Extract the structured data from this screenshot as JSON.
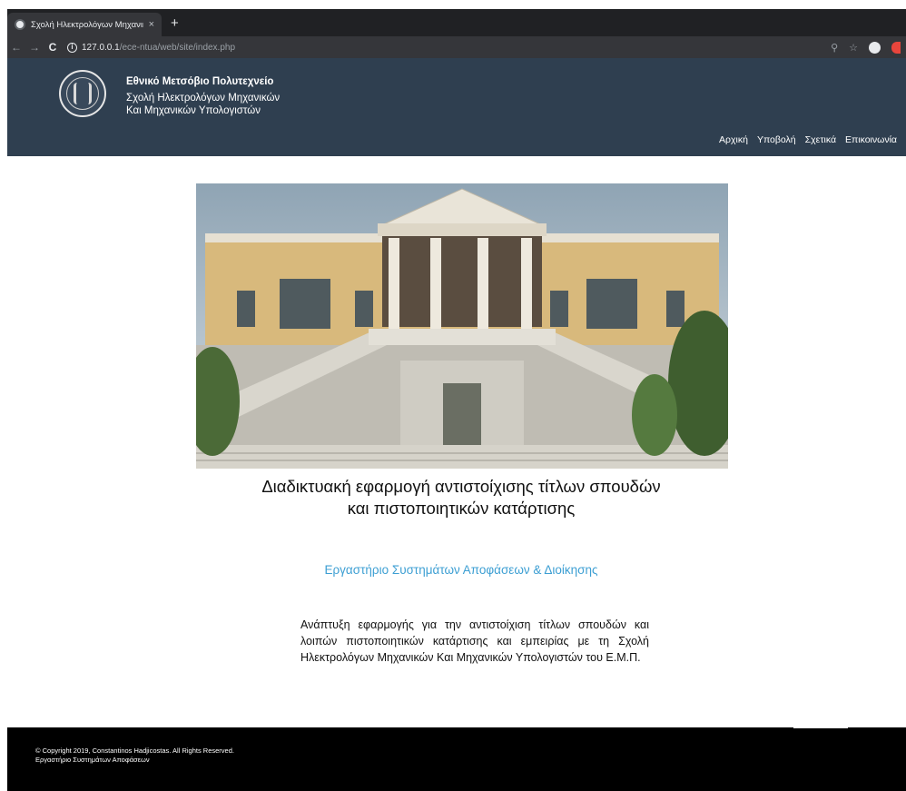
{
  "browser": {
    "tab_title": "Σχολή Ηλεκτρολόγων Μηχανικ",
    "tab_close": "×",
    "new_tab": "+",
    "back": "←",
    "forward": "→",
    "reload": "C",
    "url_host": "127.0.0.1",
    "url_path": "/ece-ntua/web/site/index.php",
    "icons": [
      "tab-favicon",
      "close-icon",
      "back-icon",
      "forward-icon",
      "reload-icon",
      "info-icon",
      "zoom-icon",
      "star-icon",
      "profile-icon",
      "extension-icon"
    ]
  },
  "header": {
    "title": "Εθνικό Μετσόβιο Πολυτεχνείο",
    "line1": "Σχολή Ηλεκτρολόγων Μηχανικών",
    "line2": "Και Μηχανικών Υπολογιστών",
    "nav": [
      "Αρχική",
      "Υποβολή",
      "Σχετικά",
      "Επικοινωνία"
    ]
  },
  "main": {
    "headline_line1": "Διαδικτυακή εφαρμογή αντιστοίχισης τίτλων σπουδών",
    "headline_line2": "και πιστοποιητικών κατάρτισης",
    "lab_title": "Εργαστήριο Συστημάτων Αποφάσεων & Διοίκησης",
    "description": "Ανάπτυξη εφαρμογής για την αντιστοίχιση τίτλων σπουδών και λοιπών πιστοποιητικών κατάρτισης και εμπειρίας με τη Σχολή Ηλεκτρολόγων Μηχανικών Και Μηχανικών Υπολογιστών του Ε.Μ.Π."
  },
  "footer": {
    "copyright": "© Copyright 2019, Constantinos Hadjicostas. All Rights Reserved.",
    "lab": "Εργαστήριο Συστημάτων Αποφάσεων"
  },
  "colors": {
    "header_bg": "#2f3f50",
    "lab_title": "#3d9fd3",
    "footer_bg": "#000000"
  }
}
